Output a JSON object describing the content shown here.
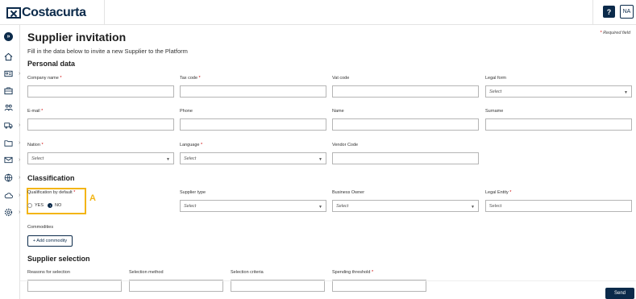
{
  "header": {
    "logo_text": "Costacurta",
    "help_label": "?",
    "avatar_initials": "NA"
  },
  "sidebar": {
    "expand_icon": "chevrons-right-icon",
    "items": [
      {
        "icon": "home-icon"
      },
      {
        "icon": "id-card-icon"
      },
      {
        "icon": "briefcase-icon"
      },
      {
        "icon": "users-icon"
      },
      {
        "icon": "truck-icon"
      },
      {
        "icon": "folder-icon"
      },
      {
        "icon": "mail-icon"
      },
      {
        "icon": "globe-icon"
      },
      {
        "icon": "cloud-icon"
      },
      {
        "icon": "gear-icon"
      }
    ]
  },
  "page": {
    "title": "Supplier invitation",
    "required_note": "Required field",
    "required_star": "*",
    "subtitle": "Fill in the data below to invite a new Supplier to the Platform"
  },
  "personal_data": {
    "title": "Personal data",
    "company_name": {
      "label": "Company name",
      "star": "*",
      "value": ""
    },
    "tax_code": {
      "label": "Tax code",
      "star": "*",
      "value": ""
    },
    "vat_code": {
      "label": "Vat code",
      "value": ""
    },
    "legal_form": {
      "label": "Legal form",
      "placeholder": "Select"
    },
    "email": {
      "label": "E-mail",
      "star": "*",
      "value": ""
    },
    "phone": {
      "label": "Phone",
      "value": ""
    },
    "name": {
      "label": "Name",
      "value": ""
    },
    "surname": {
      "label": "Surname",
      "value": ""
    },
    "nation": {
      "label": "Nation",
      "star": "*",
      "placeholder": "Select"
    },
    "language": {
      "label": "Language",
      "star": "*",
      "placeholder": "Select"
    },
    "vendor_code": {
      "label": "Vendor Code",
      "value": ""
    }
  },
  "classification": {
    "title": "Classification",
    "qualification": {
      "label": "Qualification by default",
      "star": "*",
      "yes_label": "YES",
      "no_label": "NO",
      "selected": "NO"
    },
    "annotation": "A",
    "supplier_type": {
      "label": "Supplier type",
      "placeholder": "Select"
    },
    "business_owner": {
      "label": "Business Owner",
      "placeholder": "Select"
    },
    "legal_entity": {
      "label": "Legal Entity",
      "star": "*",
      "placeholder": "Select"
    },
    "commodities_label": "Commodities",
    "add_commodity_label": "+ Add commodity"
  },
  "supplier_selection": {
    "title": "Supplier selection",
    "reasons": {
      "label": "Reasons for selection"
    },
    "method": {
      "label": "Selection method"
    },
    "criteria": {
      "label": "Selection criteria"
    },
    "threshold": {
      "label": "Spending threshold",
      "star": "*"
    }
  },
  "footer": {
    "send_label": "Send"
  }
}
